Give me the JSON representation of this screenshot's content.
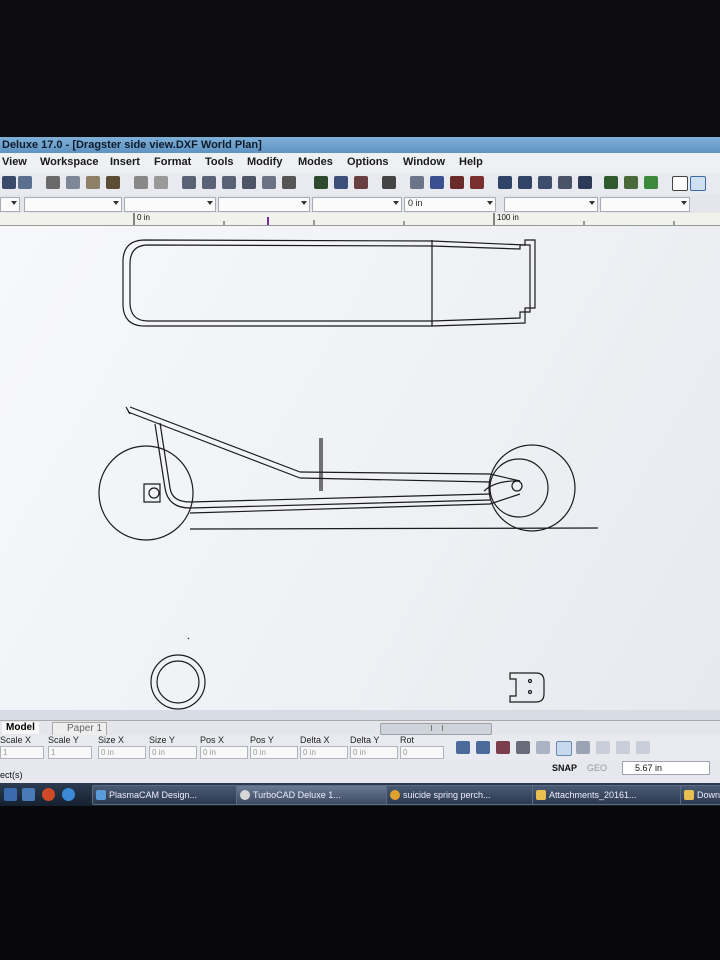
{
  "window": {
    "title": "Deluxe 17.0 - [Dragster side view.DXF World Plan]"
  },
  "menu": [
    "View",
    "Workspace",
    "Insert",
    "Format",
    "Tools",
    "Modify",
    "Modes",
    "Options",
    "Window",
    "Help"
  ],
  "property_bar": {
    "offset_value": "0 in"
  },
  "ruler": {
    "label_0": "0 in",
    "label_100": "100 in"
  },
  "tabs": {
    "model": "Model",
    "paper": "Paper 1"
  },
  "coords": {
    "headers": [
      "Scale X",
      "Scale Y",
      "Size X",
      "Size Y",
      "Pos X",
      "Pos Y",
      "Delta X",
      "Delta Y",
      "Rot"
    ],
    "values": [
      "1",
      "1",
      "0 in",
      "0 in",
      "0 in",
      "0 in",
      "0 in",
      "0 in",
      "0"
    ]
  },
  "status": {
    "left": "ect(s)",
    "snap": "SNAP",
    "geo": "GEO",
    "grid_value": "5.67 in"
  },
  "taskbar": {
    "items": [
      "PlasmaCAM Design...",
      "TurboCAD Deluxe 1...",
      "suicide spring perch...",
      "Attachments_20161...",
      "Down"
    ]
  },
  "icons": {
    "drawing": "dragster-frame-drawing",
    "scrollbar_grip": "scrollbar-grip-icon"
  }
}
